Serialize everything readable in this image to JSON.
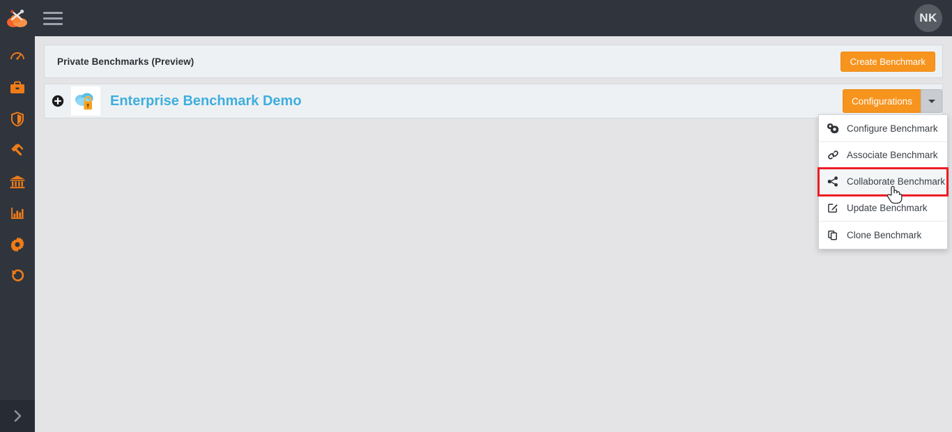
{
  "topbar": {
    "logo_icon": "cloud-tools-logo-icon",
    "menu_icon": "hamburger-menu-icon",
    "avatar_initials": "NK",
    "background_color": "#2f343d"
  },
  "sidebar": {
    "background_color": "#2f343d",
    "icon_color": "#f07c18",
    "items": [
      {
        "icon": "speedometer-dashboard-icon",
        "label": "Dashboard"
      },
      {
        "icon": "briefcase-icon",
        "label": "Portfolio"
      },
      {
        "icon": "shield-icon",
        "label": "Security"
      },
      {
        "icon": "gavel-icon",
        "label": "Compliance"
      },
      {
        "icon": "bank-institution-icon",
        "label": "Institutions"
      },
      {
        "icon": "bar-chart-icon",
        "label": "Reports"
      },
      {
        "icon": "gear-icon",
        "label": "Settings"
      },
      {
        "icon": "history-undo-icon",
        "label": "History"
      }
    ],
    "collapse_toggle_icon": "chevron-right-icon"
  },
  "header_panel": {
    "title": "Private Benchmarks (Preview)",
    "create_button_label": "Create Benchmark",
    "create_button_color": "#f7941e"
  },
  "benchmark_row": {
    "expand_icon": "plus-circle-icon",
    "thumbnail_icon": "cloud-lock-icon",
    "name": "Enterprise Benchmark Demo",
    "name_color": "#3eaede",
    "configurations_button_label": "Configurations",
    "configurations_caret_icon": "caret-down-icon"
  },
  "dropdown_menu": {
    "highlight_color": "#ee1c25",
    "items": [
      {
        "icon": "cogs-icon",
        "label": "Configure Benchmark",
        "highlighted": false
      },
      {
        "icon": "link-chain-icon",
        "label": "Associate Benchmark",
        "highlighted": false
      },
      {
        "icon": "share-alt-icon",
        "label": "Collaborate Benchmark",
        "highlighted": true
      },
      {
        "icon": "pen-square-icon",
        "label": "Update Benchmark",
        "highlighted": false
      },
      {
        "icon": "copy-clone-icon",
        "label": "Clone Benchmark",
        "highlighted": false
      }
    ]
  },
  "cursor": {
    "icon": "pointing-hand-cursor-icon"
  }
}
